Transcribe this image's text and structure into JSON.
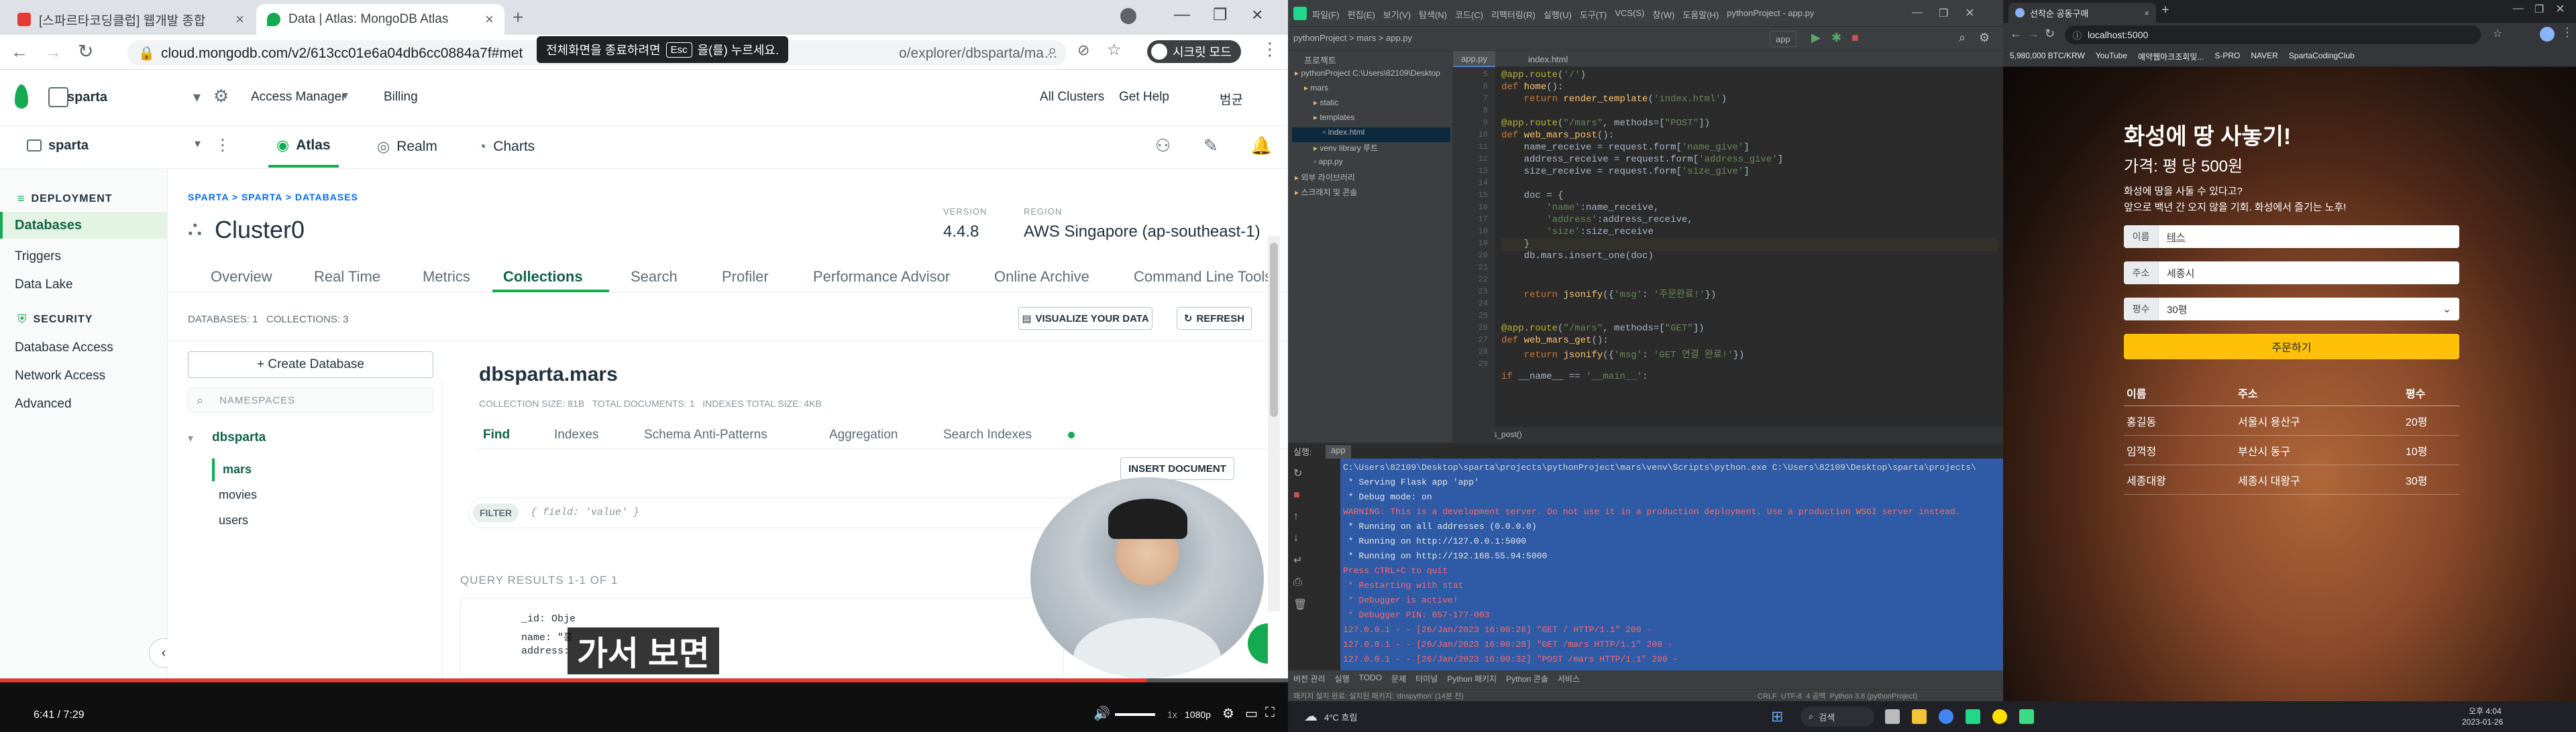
{
  "browser": {
    "tabs": [
      {
        "title": "[스파르타코딩클럽] 웹개발 종합",
        "color": "#e53935"
      },
      {
        "title": "Data | Atlas: MongoDB Atlas",
        "color": "#13aa52"
      }
    ],
    "url": "cloud.mongodb.com/v2/613cc01e6a04db6cc0884a7f#met",
    "url_tail": "o/explorer/dbsparta/mars/find",
    "fullscreen_notice_pre": "전체화면을 종료하려면",
    "fullscreen_key": "Esc",
    "fullscreen_notice_post": "을(를) 누르세요.",
    "profile_label": "시크릿 모드"
  },
  "atlas": {
    "org": "sparta",
    "top_links": [
      "Access Manager",
      "Billing"
    ],
    "right_links": [
      "All Clusters",
      "Get Help",
      "범균"
    ],
    "project": "sparta",
    "nav_tabs": [
      "Atlas",
      "Realm",
      "Charts"
    ],
    "sidebar": {
      "deployment_title": "DEPLOYMENT",
      "deployment_items": [
        "Databases",
        "Triggers",
        "Data Lake"
      ],
      "security_title": "SECURITY",
      "security_items": [
        "Database Access",
        "Network Access",
        "Advanced"
      ]
    },
    "breadcrumb": "SPARTA > SPARTA > DATABASES",
    "cluster_name": "Cluster0",
    "version_label": "VERSION",
    "version_value": "4.4.8",
    "region_label": "REGION",
    "region_value": "AWS Singapore (ap-southeast-1)",
    "cluster_tabs": [
      "Overview",
      "Real Time",
      "Metrics",
      "Collections",
      "Search",
      "Profiler",
      "Performance Advisor",
      "Online Archive",
      "Command Line Tools"
    ],
    "db_count": "DATABASES: 1   COLLECTIONS: 3",
    "visualize_btn": "VISUALIZE YOUR DATA",
    "refresh_btn": "REFRESH",
    "create_db_btn": "+ Create Database",
    "namespace_placeholder": "NAMESPACES",
    "db_name": "dbsparta",
    "collections": [
      "mars",
      "movies",
      "users"
    ],
    "collection_title": "dbsparta.mars",
    "collection_stats": "COLLECTION SIZE: 81B   TOTAL DOCUMENTS: 1   INDEXES TOTAL SIZE: 4KB",
    "doc_tabs": [
      "Find",
      "Indexes",
      "Schema Anti-Patterns",
      "Aggregation",
      "Search Indexes"
    ],
    "insert_btn": "INSERT DOCUMENT",
    "filter_label": "FILTER",
    "filter_placeholder": "{ field: 'value' }",
    "query_results": "QUERY RESULTS 1-1 OF 1",
    "doc_lines": [
      "_id: Obje",
      "name: \"홍",
      "address: "
    ]
  },
  "video": {
    "subtitle": "가서 보면",
    "time": "6:41 / 7:29",
    "progress": 0.89,
    "quality": "1080p",
    "speed": "1x"
  },
  "ide": {
    "menu": [
      "파일(F)",
      "편집(E)",
      "보기(V)",
      "탐색(N)",
      "코드(C)",
      "리팩터링(R)",
      "실행(U)",
      "도구(T)",
      "VCS(S)",
      "창(W)",
      "도움말(H)",
      "pythonProject - app.py"
    ],
    "breadcrumb": "pythonProject  >  mars  >  app.py",
    "run_config": "app",
    "project_title": "프로젝트",
    "tree": [
      {
        "label": "pythonProject  C:\\Users\\82109\\Desktop",
        "indent": 0
      },
      {
        "label": "mars",
        "indent": 1
      },
      {
        "label": "static",
        "indent": 2
      },
      {
        "label": "templates",
        "indent": 2
      },
      {
        "label": "index.html",
        "indent": 3
      },
      {
        "label": "venv  library 루트",
        "indent": 2
      },
      {
        "label": "app.py",
        "indent": 2
      },
      {
        "label": "외부 라이브러리",
        "indent": 0
      },
      {
        "label": "스크래치 및 콘솔",
        "indent": 0
      }
    ],
    "editor_tabs": [
      "app.py",
      "index.html"
    ],
    "line_numbers": [
      "5",
      "6",
      "7",
      "8",
      "9",
      "10",
      "11",
      "12",
      "13",
      "14",
      "15",
      "16",
      "17",
      "18",
      "19",
      "20",
      "21",
      "22",
      "23",
      "24",
      "25",
      "26",
      "27",
      "28",
      "29"
    ],
    "code_lines": [
      "@app.route('/')",
      "def home():",
      "    return render_template('index.html')",
      "",
      "@app.route(\"/mars\", methods=[\"POST\"])",
      "def web_mars_post():",
      "    name_receive = request.form['name_give']",
      "    address_receive = request.form['address_give']",
      "    size_receive = request.form['size_give']",
      "",
      "    doc = {",
      "        'name':name_receive,",
      "        'address':address_receive,",
      "        'size':size_receive",
      "    }",
      "    db.mars.insert_one(doc)",
      "",
      "",
      "    return jsonify({'msg': '주문완료!'})",
      "",
      "",
      "@app.route(\"/mars\", methods=[\"GET\"])",
      "def web_mars_get():",
      "    return jsonify({'msg': 'GET 연결 완료!'})",
      "",
      "if __name__ == '__main__':"
    ],
    "editor_footer": "web_mars_post()",
    "run_tab": "실행:",
    "run_name": "app",
    "console": [
      "C:\\Users\\82109\\Desktop\\sparta\\projects\\pythonProject\\mars\\venv\\Scripts\\python.exe C:\\Users\\82109\\Desktop\\sparta\\projects\\",
      " * Serving Flask app 'app'",
      " * Debug mode: on",
      "WARNING: This is a development server. Do not use it in a production deployment. Use a production WSGI server instead.",
      " * Running on all addresses (0.0.0.0)",
      " * Running on http://127.0.0.1:5000",
      " * Running on http://192.168.55.94:5000",
      "Press CTRL+C to quit",
      " * Restarting with stat",
      " * Debugger is active!",
      " * Debugger PIN: 657-177-003",
      "127.0.0.1 - - [26/Jan/2023 16:00:28] \"GET / HTTP/1.1\" 200 -",
      "127.0.0.1 - - [26/Jan/2023 16:00:28] \"GET /mars HTTP/1.1\" 200 -",
      "127.0.0.1 - - [26/Jan/2023 16:00:32] \"POST /mars HTTP/1.1\" 200 -"
    ],
    "bottom_tabs": [
      "버전 관리",
      "실행",
      "TODO",
      "문제",
      "터미널",
      "Python 패키지",
      "Python 콘솔",
      "서비스"
    ],
    "status_text": "CRLF  UTF-8  4 공백  Python 3.8 (pythonProject)",
    "status_left": "패키지 설치 완료: 설치된 패키지: 'dnspython' (14분 전)"
  },
  "taskbar": {
    "weather": "4°C 흐림",
    "search": "검색",
    "time": "오후 4:04",
    "date": "2023-01-26"
  },
  "web": {
    "tab_title": "선착순 공동구매",
    "url": "localhost:5000",
    "bookmarks": [
      "5,980,000 BTC/KRW",
      "YouTube",
      "예약웹마크조회및...",
      "S-PRO",
      "NAVER",
      "SpartaCodingClub"
    ],
    "title": "화성에 땅 사놓기!",
    "price": "가격: 평 당 500원",
    "desc1": "화성에 땅을 사둘 수 있다고?",
    "desc2": "앞으로 백년 간 오지 않을 기회. 화성에서 즐기는 노후!",
    "form": {
      "name_label": "이름",
      "name_value": "테스",
      "address_label": "주소",
      "address_value": "세종시",
      "size_label": "평수",
      "size_value": "30평",
      "submit": "주문하기"
    },
    "table_headers": [
      "이름",
      "주소",
      "평수"
    ],
    "rows": [
      [
        "홍길동",
        "서울시 용산구",
        "20평"
      ],
      [
        "임꺽정",
        "부산시 동구",
        "10평"
      ],
      [
        "세종대왕",
        "세종시 대왕구",
        "30평"
      ]
    ]
  }
}
